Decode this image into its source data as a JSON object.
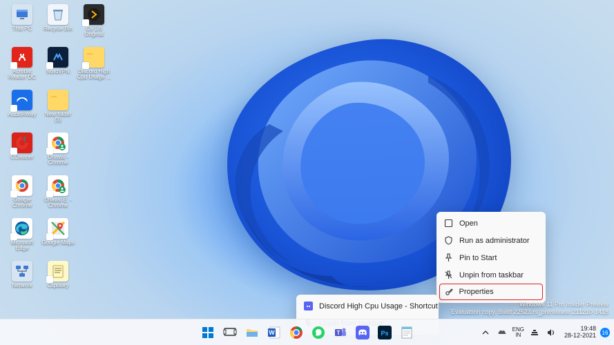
{
  "desktop_icons": [
    [
      {
        "name": "this-pc",
        "label": "This PC",
        "bg": "#d7e4f2",
        "glyph": "pc"
      },
      {
        "name": "recycle-bin",
        "label": "Recycle Bin",
        "bg": "#f2f6fb",
        "glyph": "bin"
      },
      {
        "name": "cs-original",
        "label": "Cs 1.6 Original",
        "bg": "#2b2b2b",
        "glyph": "cs",
        "shortcut": true
      }
    ],
    [
      {
        "name": "acrobat",
        "label": "Acrobat Reader DC",
        "bg": "#e1251b",
        "glyph": "acro",
        "shortcut": true
      },
      {
        "name": "nordvpn",
        "label": "NordVPN",
        "bg": "#0b1f3a",
        "glyph": "nord",
        "shortcut": true
      },
      {
        "name": "discord-shortcut",
        "label": "Discord High Cpu Usage ...",
        "bg": "#ffd867",
        "glyph": "folder",
        "shortcut": true
      }
    ],
    [
      {
        "name": "audiorelay",
        "label": "AudioRelay",
        "bg": "#1a6fe8",
        "glyph": "relay",
        "shortcut": true
      },
      {
        "name": "new-folder",
        "label": "New folder (3)",
        "bg": "#ffd867",
        "glyph": "folder"
      }
    ],
    [
      {
        "name": "ccleaner",
        "label": "CCleaner",
        "bg": "#d8241c",
        "glyph": "cc",
        "shortcut": true
      },
      {
        "name": "dhaval-chrome",
        "label": "Dhaval - Chrome",
        "bg": "#ffffff",
        "glyph": "chrome-badge",
        "shortcut": true
      }
    ],
    [
      {
        "name": "google-chrome",
        "label": "Google Chrome",
        "bg": "#ffffff",
        "glyph": "chrome",
        "shortcut": true
      },
      {
        "name": "dhaval2-chrome",
        "label": "Dhaval E. - Chrome",
        "bg": "#ffffff",
        "glyph": "chrome-badge",
        "shortcut": true
      }
    ],
    [
      {
        "name": "edge",
        "label": "Microsoft Edge",
        "bg": "#ffffff",
        "glyph": "edge",
        "shortcut": true
      },
      {
        "name": "google-maps",
        "label": "Google Maps",
        "bg": "#ffffff",
        "glyph": "maps",
        "shortcut": true
      }
    ],
    [
      {
        "name": "network",
        "label": "Network",
        "bg": "#d7e4f2",
        "glyph": "net"
      },
      {
        "name": "clipdiary",
        "label": "Clipdiary",
        "bg": "#fff8c8",
        "glyph": "clip",
        "shortcut": true
      }
    ]
  ],
  "context_menu_main": {
    "items": [
      {
        "icon": "open",
        "label": "Open"
      },
      {
        "icon": "admin",
        "label": "Run as administrator"
      },
      {
        "icon": "pin",
        "label": "Pin to Start"
      },
      {
        "icon": "unpin",
        "label": "Unpin from taskbar"
      },
      {
        "icon": "props",
        "label": "Properties",
        "highlight": true
      }
    ]
  },
  "context_menu_taskbar": {
    "items": [
      {
        "icon": "discord",
        "label": "Discord High Cpu Usage - Shortcut"
      },
      {
        "icon": "unpin",
        "label": "Unpin from taskbar"
      }
    ]
  },
  "watermark": {
    "line1": "Windows 11 Pro Insider Preview",
    "line2": "Evaluation copy. Build 22523.rs_prerelease.211210-1418"
  },
  "taskbar": {
    "items": [
      {
        "name": "start-button",
        "glyph": "start"
      },
      {
        "name": "task-view",
        "glyph": "taskview"
      },
      {
        "name": "explorer",
        "glyph": "explorer"
      },
      {
        "name": "word",
        "glyph": "word"
      },
      {
        "name": "chrome",
        "glyph": "chrome"
      },
      {
        "name": "whatsapp",
        "glyph": "whatsapp"
      },
      {
        "name": "teams",
        "glyph": "teams"
      },
      {
        "name": "discord",
        "glyph": "discord"
      },
      {
        "name": "photoshop",
        "glyph": "ps"
      },
      {
        "name": "notepad",
        "glyph": "notepad"
      }
    ]
  },
  "systray": {
    "lang1": "ENG",
    "lang2": "IN",
    "time": "19:48",
    "date": "28-12-2021",
    "notif_count": "16"
  }
}
